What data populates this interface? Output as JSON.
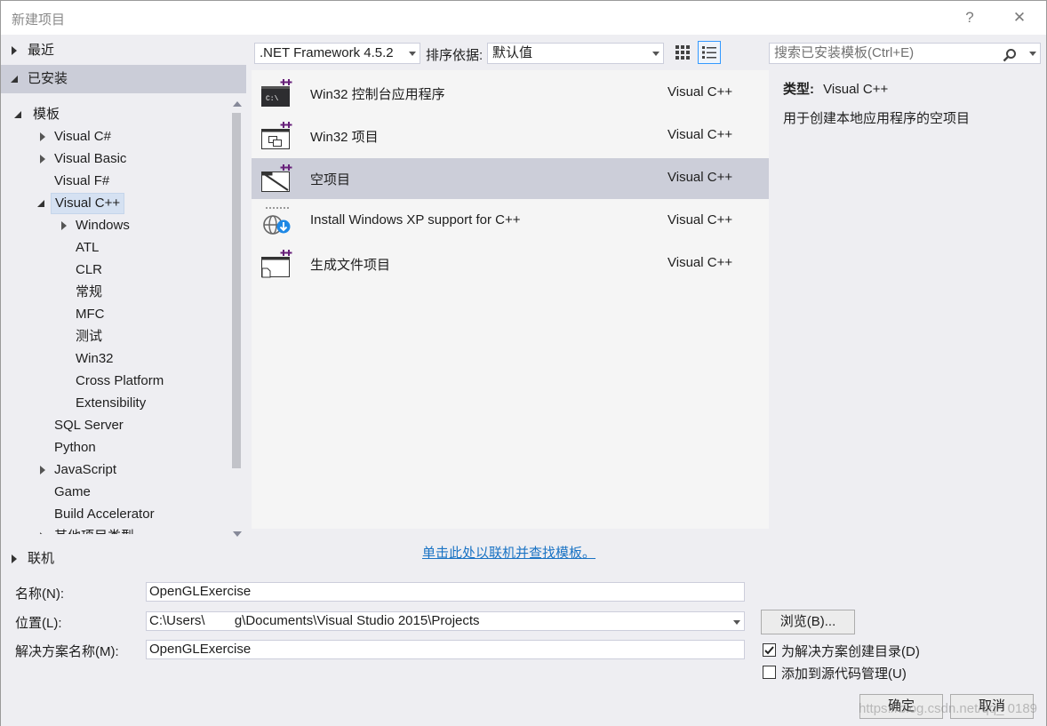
{
  "window": {
    "title": "新建项目",
    "help": "?",
    "close": "✕"
  },
  "sidebar": {
    "recent": "最近",
    "installed": "已安装",
    "online": "联机",
    "tree": [
      {
        "label": "模板",
        "level": 0,
        "expand": "expanded"
      },
      {
        "label": "Visual C#",
        "level": 1,
        "expand": "collapsed"
      },
      {
        "label": "Visual Basic",
        "level": 1,
        "expand": "collapsed"
      },
      {
        "label": "Visual F#",
        "level": 1,
        "expand": "none"
      },
      {
        "label": "Visual C++",
        "level": 1,
        "expand": "expanded",
        "selected": true
      },
      {
        "label": "Windows",
        "level": 2,
        "expand": "collapsed"
      },
      {
        "label": "ATL",
        "level": 2,
        "expand": "none"
      },
      {
        "label": "CLR",
        "level": 2,
        "expand": "none"
      },
      {
        "label": "常规",
        "level": 2,
        "expand": "none"
      },
      {
        "label": "MFC",
        "level": 2,
        "expand": "none"
      },
      {
        "label": "测试",
        "level": 2,
        "expand": "none"
      },
      {
        "label": "Win32",
        "level": 2,
        "expand": "none"
      },
      {
        "label": "Cross Platform",
        "level": 2,
        "expand": "none"
      },
      {
        "label": "Extensibility",
        "level": 2,
        "expand": "none"
      },
      {
        "label": "SQL Server",
        "level": 1,
        "expand": "none"
      },
      {
        "label": "Python",
        "level": 1,
        "expand": "none"
      },
      {
        "label": "JavaScript",
        "level": 1,
        "expand": "collapsed"
      },
      {
        "label": "Game",
        "level": 1,
        "expand": "none"
      },
      {
        "label": "Build Accelerator",
        "level": 1,
        "expand": "none"
      },
      {
        "label": "其他项目类型",
        "level": 1,
        "expand": "collapsed"
      }
    ]
  },
  "toolbar": {
    "framework": ".NET Framework 4.5.2",
    "sort_label": "排序依据:",
    "sort_value": "默认值",
    "search_placeholder": "搜索已安装模板(Ctrl+E)"
  },
  "templates": [
    {
      "name": "Win32 控制台应用程序",
      "lang": "Visual C++",
      "icon": "console-app-icon"
    },
    {
      "name": "Win32 项目",
      "lang": "Visual C++",
      "icon": "win32-project-icon"
    },
    {
      "name": "空项目",
      "lang": "Visual C++",
      "icon": "empty-project-icon",
      "selected": true
    },
    {
      "name": "Install Windows XP support for C++",
      "lang": "Visual C++",
      "icon": "globe-download-icon"
    },
    {
      "name": "生成文件项目",
      "lang": "Visual C++",
      "icon": "makefile-project-icon"
    }
  ],
  "description": {
    "type_label": "类型:",
    "type_value": "Visual C++",
    "text": "用于创建本地应用程序的空项目"
  },
  "online_link": "单击此处以联机并查找模板。",
  "form": {
    "name_label": "名称(N):",
    "name_value": "OpenGLExercise",
    "location_label": "位置(L):",
    "location_value": "C:\\Users\\        g\\Documents\\Visual Studio 2015\\Projects",
    "solution_label": "解决方案名称(M):",
    "solution_value": "OpenGLExercise",
    "browse": "浏览(B)...",
    "create_dir": "为解决方案创建目录(D)",
    "create_dir_checked": true,
    "add_source_control": "添加到源代码管理(U)",
    "add_source_control_checked": false,
    "ok": "确定",
    "cancel": "取消"
  },
  "watermark": "https://blog.csdn.net/qq_      0189",
  "colors": {
    "accent": "#3399ff",
    "selection": "#ccced9",
    "link": "#1a73c4",
    "background": "#eeeef2"
  }
}
